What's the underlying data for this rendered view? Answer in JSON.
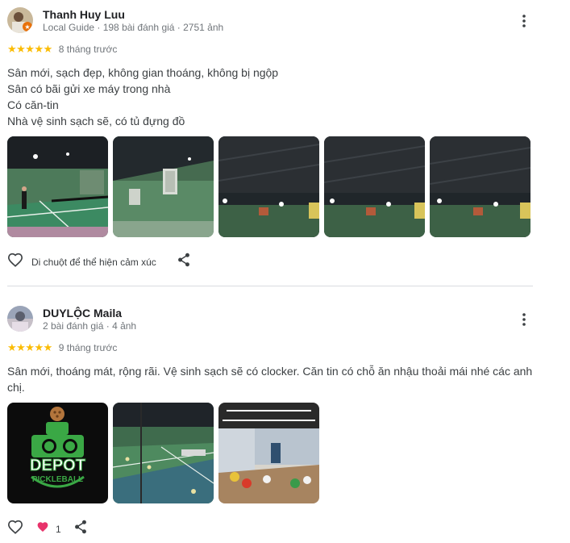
{
  "reviews": [
    {
      "reviewer_name": "Thanh Huy Luu",
      "reviewer_meta": "Local Guide · 198 bài đánh giá · 2751 ảnh",
      "stars": "★★★★★",
      "date": "8 tháng trước",
      "text_lines": [
        "Sân mới, sạch đẹp, không gian thoáng, không bị ngộp",
        "Sân có bãi gửi xe máy trong nhà",
        "Có căn-tin",
        "Nhà vệ sinh sạch sẽ, có tủ đựng đồ"
      ],
      "react_label": "Di chuột để thể hiện cảm xúc",
      "photos": [
        "court-photo-1",
        "court-photo-2",
        "court-photo-3",
        "court-photo-4",
        "court-photo-5"
      ]
    },
    {
      "reviewer_name": "DUYLỘC Maila",
      "reviewer_meta": "2 bài đánh giá · 4 ảnh",
      "stars": "★★★★★",
      "date": "9 tháng trước",
      "text_lines": [
        "Sân mới, thoáng mát, rộng rãi. Vệ sinh sạch sẽ có clocker. Căn tin có chỗ ăn nhậu thoải mái nhé các anh",
        "chị."
      ],
      "like_count": "1",
      "logo_text": {
        "line1": "DEPOT",
        "line2": "PICKLEBALL"
      },
      "photos": [
        "depot-logo",
        "court-photo",
        "canteen-photo"
      ]
    }
  ],
  "colors": {
    "star": "#fbbc04",
    "meta": "#70757a",
    "heart_filled": "#e8336b",
    "logo_green": "#3aa845"
  },
  "icons": [
    "more-vert-icon",
    "heart-outline-icon",
    "share-icon",
    "heart-filled-icon"
  ]
}
